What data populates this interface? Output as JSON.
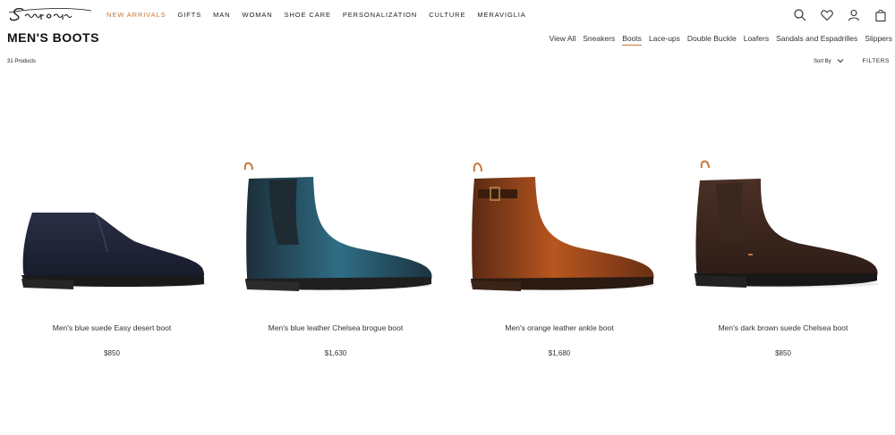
{
  "brand": {
    "logo_text": "Santoni"
  },
  "main_nav": [
    {
      "label": "NEW ARRIVALS",
      "accent": true
    },
    {
      "label": "GIFTS"
    },
    {
      "label": "MAN"
    },
    {
      "label": "WOMAN"
    },
    {
      "label": "SHOE CARE"
    },
    {
      "label": "PERSONALIZATION"
    },
    {
      "label": "CULTURE"
    },
    {
      "label": "MERAVIGLIA"
    }
  ],
  "header_icons": [
    "search-icon",
    "heart-icon",
    "user-icon",
    "bag-icon"
  ],
  "page": {
    "title": "MEN'S BOOTS"
  },
  "sub_nav": [
    {
      "label": "View All"
    },
    {
      "label": "Sneakers"
    },
    {
      "label": "Boots",
      "active": true
    },
    {
      "label": "Lace-ups"
    },
    {
      "label": "Double Buckle"
    },
    {
      "label": "Loafers"
    },
    {
      "label": "Sandals and Espadrilles"
    },
    {
      "label": "Slippers"
    }
  ],
  "toolbar": {
    "count": "31 Products",
    "sort_label": "Sort By",
    "filters_label": "FILTERS"
  },
  "products": [
    {
      "name": "Men's blue suede Easy desert boot",
      "price": "$850"
    },
    {
      "name": "Men's blue leather Chelsea brogue boot",
      "price": "$1,630"
    },
    {
      "name": "Men's orange leather ankle boot",
      "price": "$1,680"
    },
    {
      "name": "Men's dark brown suede Chelsea boot",
      "price": "$850"
    }
  ],
  "colors": {
    "accent": "#c7773c",
    "text": "#222222"
  }
}
